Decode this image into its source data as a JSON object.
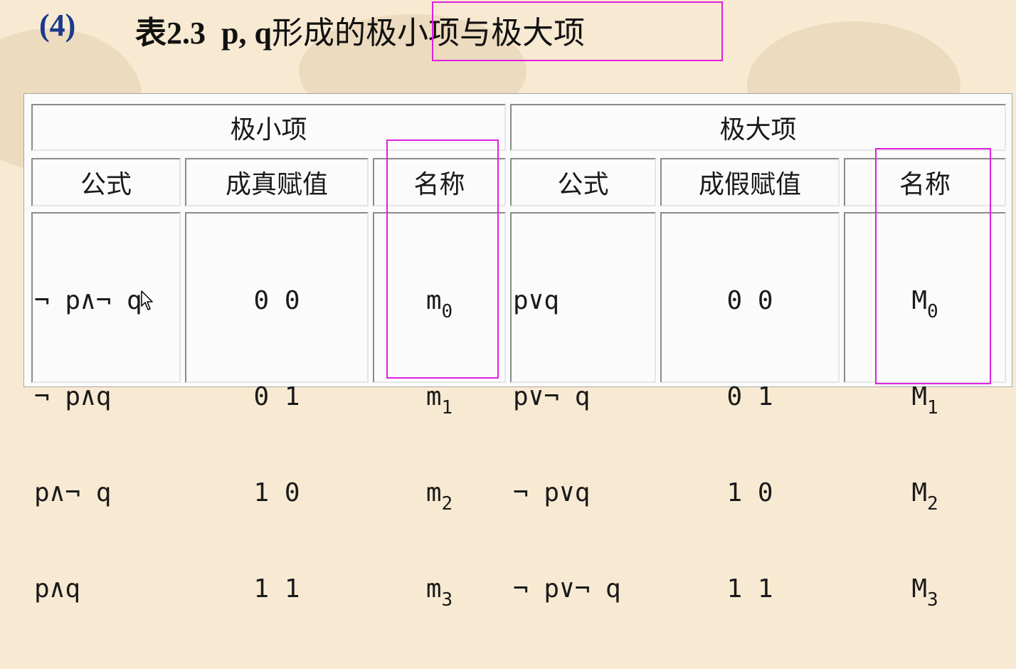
{
  "heading": {
    "number": "(4)",
    "title_prefix": "表2.3",
    "title_vars": "p, q",
    "title_mid": "形成的",
    "title_highlight": "极小项与极大项"
  },
  "table": {
    "minterm_group": "极小项",
    "maxterm_group": "极大项",
    "minterm_columns": [
      "公式",
      "成真赋值",
      "名称"
    ],
    "maxterm_columns": [
      "公式",
      "成假赋值",
      "名称"
    ],
    "minterm_rows": [
      {
        "formula": "¬ p∧¬ q",
        "assignment": "0 0",
        "name_base": "m",
        "name_sub": "0"
      },
      {
        "formula": "¬ p∧q",
        "assignment": "0 1",
        "name_base": "m",
        "name_sub": "1"
      },
      {
        "formula": "p∧¬ q",
        "assignment": "1 0",
        "name_base": "m",
        "name_sub": "2"
      },
      {
        "formula": "p∧q",
        "assignment": "1 1",
        "name_base": "m",
        "name_sub": "3"
      }
    ],
    "maxterm_rows": [
      {
        "formula": "p∨q",
        "assignment": "0 0",
        "name_base": "M",
        "name_sub": "0"
      },
      {
        "formula": "p∨¬ q",
        "assignment": "0 1",
        "name_base": "M",
        "name_sub": "1"
      },
      {
        "formula": "¬ p∨q",
        "assignment": "1 0",
        "name_base": "M",
        "name_sub": "2"
      },
      {
        "formula": "¬ p∨¬ q",
        "assignment": "1 1",
        "name_base": "M",
        "name_sub": "3"
      }
    ]
  },
  "colors": {
    "background": "#f8ead2",
    "heading_number": "#1b3a8c",
    "highlight_box": "#e020e0"
  }
}
